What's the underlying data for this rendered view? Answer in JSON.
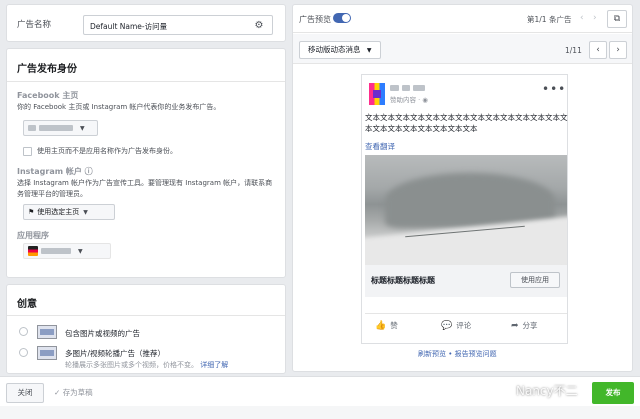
{
  "ad_name": {
    "label": "广告名称",
    "value": "Default Name-访问量",
    "settings_icon": "gear-icon"
  },
  "identity": {
    "title": "广告发布身份",
    "facebook": {
      "title": "Facebook 主页",
      "desc": "你的 Facebook 主页或 Instagram 帐户代表你的业务发布广告。",
      "checkbox_label": "使用主页而不是应用名称作为广告发布身份。"
    },
    "instagram": {
      "title": "Instagram 帐户",
      "desc": "选择 Instagram 帐户作为广告宣传工具。要管理现有 Instagram 帐户，请联系商务管理平台的管理员。",
      "select_label": "使用选定主页"
    },
    "app": {
      "title": "应用程序"
    }
  },
  "creative": {
    "title": "创意",
    "options": [
      {
        "label": "包含图片或视频的广告"
      },
      {
        "label": "多图片/视频轮播广告（推荐）"
      }
    ],
    "option2_desc": "轮播展示多张图片或多个视频，价格不变。",
    "learn_more": "详细了解"
  },
  "bottom": {
    "close": "关闭",
    "draft": "存为草稿",
    "publish": "发布",
    "watermark": "Nancy不二"
  },
  "preview": {
    "label": "广告预览",
    "toggle_on": true,
    "pager": "第1/1 条广告",
    "format": "移动版动态消息",
    "page_count": "1/11",
    "post": {
      "sponsored": "赞助内容 · ◉",
      "text": "文本文本文本文本文本文本文本文本文本文本文本文本文本文本文本文本文本文本文本文本文本",
      "see_translation": "查看翻译",
      "headline": "标题标题标题标题",
      "cta": "使用应用",
      "actions": {
        "like": "赞",
        "comment": "评论",
        "share": "分享"
      }
    },
    "links": "刷新预览 • 报告预览问题"
  },
  "colors": {
    "accent": "#4267b2",
    "publish": "#42b72a",
    "border": "#dddfe2"
  }
}
